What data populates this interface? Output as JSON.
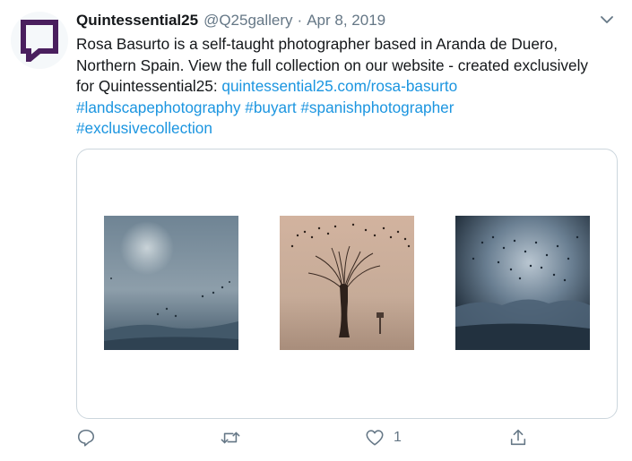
{
  "tweet": {
    "author_name": "Quintessential25",
    "handle": "@Q25gallery",
    "separator": "·",
    "date": "Apr 8, 2019",
    "text_intro": "Rosa Basurto is a self-taught photographer based in Aranda de Duero, Northern Spain. View the full collection on our website - created exclusively for Quintessential25: ",
    "link": "quintessential25.com/rosa-basurto",
    "hashtags": [
      "#landscapephotography",
      "#buyart",
      "#spanishphotographer",
      "#exclusivecollection"
    ]
  },
  "actions": {
    "reply_icon": "reply-icon",
    "retweet_icon": "retweet-icon",
    "like_icon": "heart-icon",
    "like_count": "1",
    "share_icon": "share-icon"
  },
  "colors": {
    "link": "#1b95e0",
    "muted": "#657786",
    "brand_purple": "#4a1f5e"
  },
  "media": {
    "images": [
      "misty-landscape-photo",
      "bare-tree-with-birds-photo",
      "dark-flock-of-birds-photo"
    ]
  }
}
